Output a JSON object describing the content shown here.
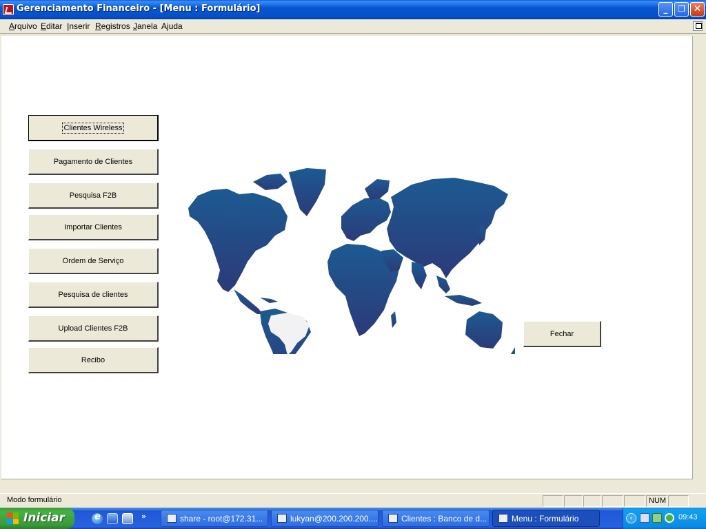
{
  "window": {
    "title": "Gerenciamento Financeiro - [Menu : Formulário]"
  },
  "menubar": {
    "items": [
      {
        "label": "Arquivo",
        "accel": "A"
      },
      {
        "label": "Editar",
        "accel": "E"
      },
      {
        "label": "Inserir",
        "accel": "I"
      },
      {
        "label": "Registros",
        "accel": "R"
      },
      {
        "label": "Janela",
        "accel": "J"
      },
      {
        "label": "Ajuda",
        "accel": "j"
      }
    ]
  },
  "form": {
    "buttons": [
      {
        "label": "Clientes Wireless",
        "default": true
      },
      {
        "label": "Pagamento de Clientes"
      },
      {
        "label": "Pesquisa F2B"
      },
      {
        "label": "Importar Clientes"
      },
      {
        "label": "Ordem de Serviço"
      },
      {
        "label": "Pesquisa de clientes"
      },
      {
        "label": "Upload Clientes F2B"
      },
      {
        "label": "Recibo"
      }
    ],
    "close_button": "Fechar",
    "map": {
      "icon": "world-map",
      "land_color": "#22427a",
      "highlight_color": "#f2f2f5",
      "highlighted_region": "Brasil"
    }
  },
  "statusbar": {
    "text": "Modo formulário",
    "num_indicator": "NUM"
  },
  "taskbar": {
    "start_label": "Iniciar",
    "quicklaunch": [
      "internet-explorer-icon",
      "media-player-icon",
      "show-desktop-icon"
    ],
    "more_label": "»",
    "tasks": [
      {
        "label": "share - root@172.31...",
        "active": false
      },
      {
        "label": "lukyan@200.200.200....",
        "active": false
      },
      {
        "label": "Clientes : Banco de d...",
        "active": false
      },
      {
        "label": "Menu : Formulário",
        "active": true
      }
    ],
    "clock": "09:43"
  },
  "colors": {
    "titlebar": "#0a5fd8",
    "face": "#ece9d8",
    "taskbar": "#2663e0",
    "start": "#3a9a3a"
  }
}
